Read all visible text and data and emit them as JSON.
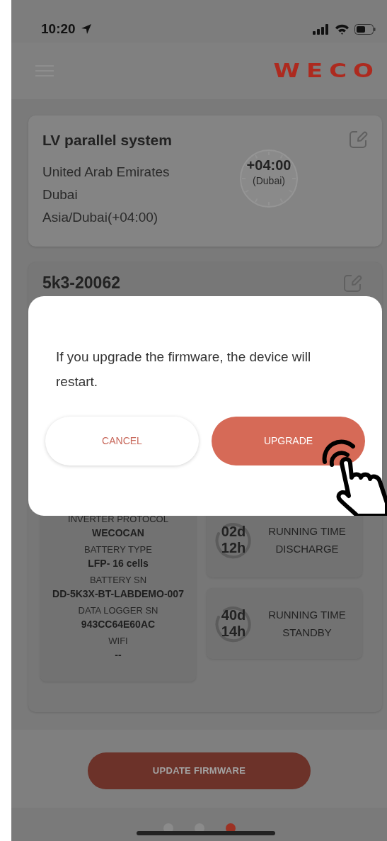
{
  "status_bar": {
    "time": "10:20"
  },
  "header": {
    "logo": "WECO"
  },
  "system_card": {
    "title": "LV parallel system",
    "lines": [
      "United Arab Emirates",
      "Dubai",
      "Asia/Dubai(+04:00)"
    ],
    "clock": {
      "offset": "+04:00",
      "city": "(Dubai)"
    }
  },
  "device_card": {
    "title": "5k3-20062",
    "info": [
      {
        "label": "INVERTER PROTOCOL",
        "value": "WECOCAN"
      },
      {
        "label": "BATTERY TYPE",
        "value": "LFP- 16 cells"
      },
      {
        "label": "BATTERY SN",
        "value": "DD-5K3X-BT-LABDEMO-007"
      },
      {
        "label": "DATA LOGGER SN",
        "value": "943CC64E60AC"
      },
      {
        "label": "WIFI",
        "value": "--"
      }
    ],
    "timers": [
      {
        "days": "02d",
        "hours": "12h",
        "label": "RUNNING TIME DISCHARGE"
      },
      {
        "days": "40d",
        "hours": "14h",
        "label": "RUNNING TIME STANDBY"
      }
    ]
  },
  "update_button": "UPDATE FIRMWARE",
  "pager": [
    {
      "selected": false
    },
    {
      "selected": false
    },
    {
      "selected": true
    }
  ],
  "dialog": {
    "message": "If you upgrade the firmware, the device will restart.",
    "buttons": [
      {
        "label": "CANCEL",
        "kind": "secondary"
      },
      {
        "label": "UPGRADE",
        "kind": "primary"
      }
    ]
  }
}
